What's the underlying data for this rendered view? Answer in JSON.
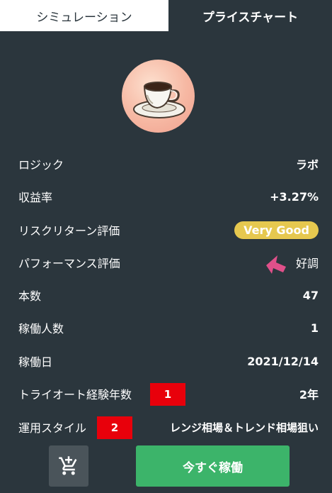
{
  "tabs": {
    "simulation": "シミュレーション",
    "price_chart": "プライスチャート"
  },
  "details": [
    {
      "label": "ロジック",
      "value": "ラボ"
    },
    {
      "label": "収益率",
      "value": "+3.27%"
    },
    {
      "label": "リスクリターン評価",
      "value": "Very Good"
    },
    {
      "label": "パフォーマンス評価",
      "value": "好調"
    },
    {
      "label": "本数",
      "value": "47"
    },
    {
      "label": "稼働人数",
      "value": "1"
    },
    {
      "label": "稼働日",
      "value": "2021/12/14"
    },
    {
      "label": "トライオート経験年数",
      "value": "2年"
    },
    {
      "label": "運用スタイル",
      "value": "レンジ相場＆トレンド相場狙い"
    }
  ],
  "markers": [
    "1",
    "2"
  ],
  "actions": {
    "run_now": "今すぐ稼働"
  },
  "colors": {
    "background": "#2b363d",
    "accent_green": "#3cb46a",
    "badge_yellow": "#e6c84f",
    "marker_red": "#e8000b",
    "arrow_pink": "#e0508a"
  },
  "icons": [
    "coffee-cup-icon",
    "cart-plus-icon",
    "arrow-icon"
  ]
}
